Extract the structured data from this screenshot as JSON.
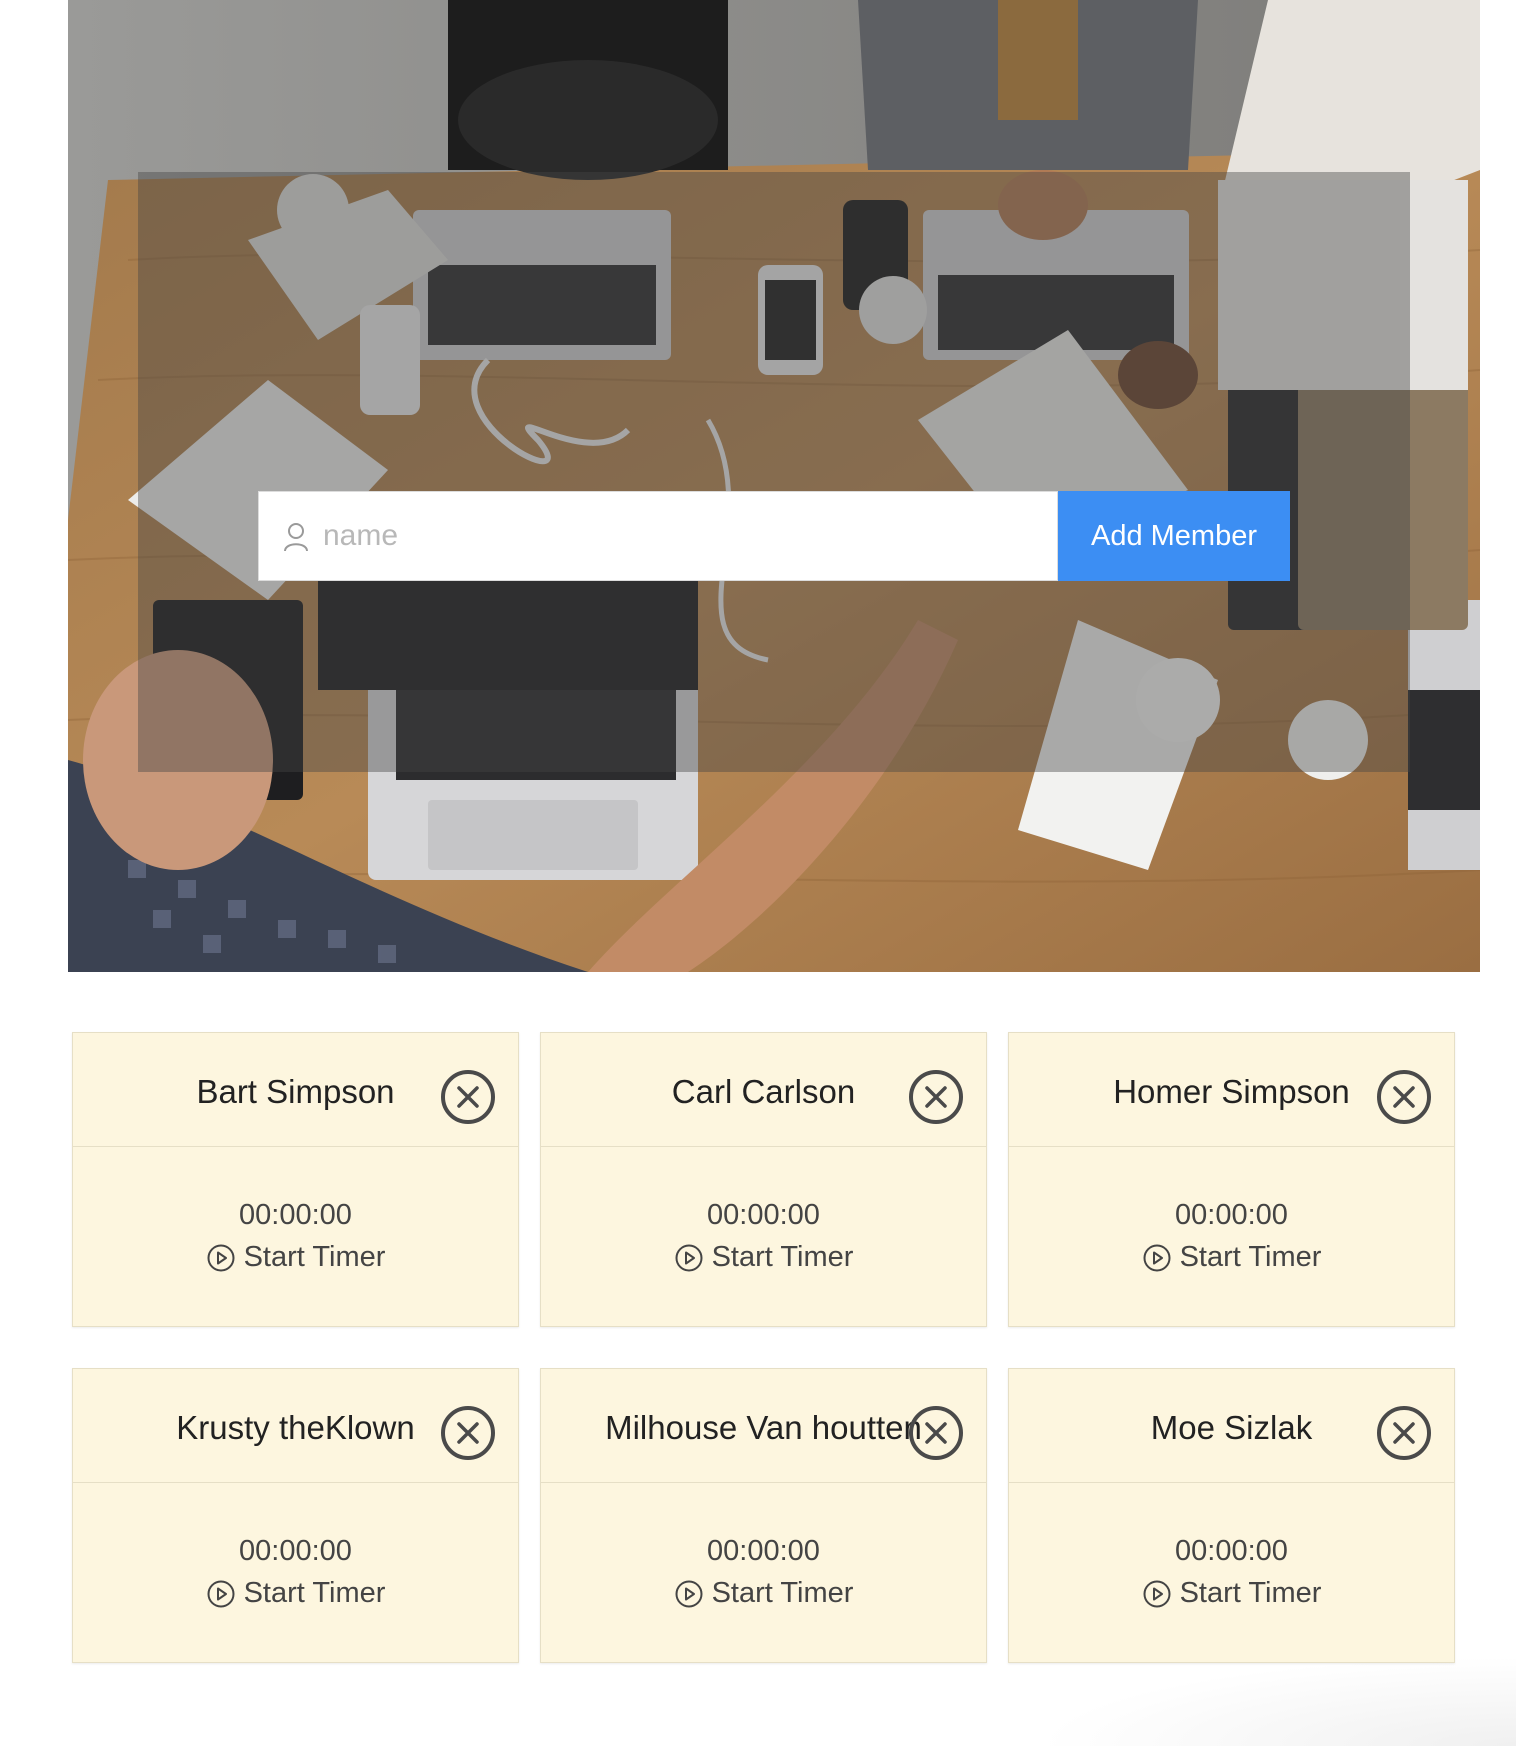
{
  "form": {
    "name_placeholder": "name",
    "name_value": "",
    "add_label": "Add Member",
    "accent": "#3c8ef3"
  },
  "members": [
    {
      "name": "Bart Simpson",
      "timer": "00:00:00",
      "action": "Start Timer"
    },
    {
      "name": "Carl Carlson",
      "timer": "00:00:00",
      "action": "Start Timer"
    },
    {
      "name": "Homer Simpson",
      "timer": "00:00:00",
      "action": "Start Timer"
    },
    {
      "name": "Krusty theKlown",
      "timer": "00:00:00",
      "action": "Start Timer"
    },
    {
      "name": "Milhouse Van houtten",
      "timer": "00:00:00",
      "action": "Start Timer"
    },
    {
      "name": "Moe Sizlak",
      "timer": "00:00:00",
      "action": "Start Timer"
    }
  ],
  "colors": {
    "card_bg": "#fdf6df",
    "card_border": "#e6dfc6"
  },
  "icons": {
    "user": "user-icon",
    "remove": "close-circle-icon",
    "play": "play-circle-icon"
  }
}
